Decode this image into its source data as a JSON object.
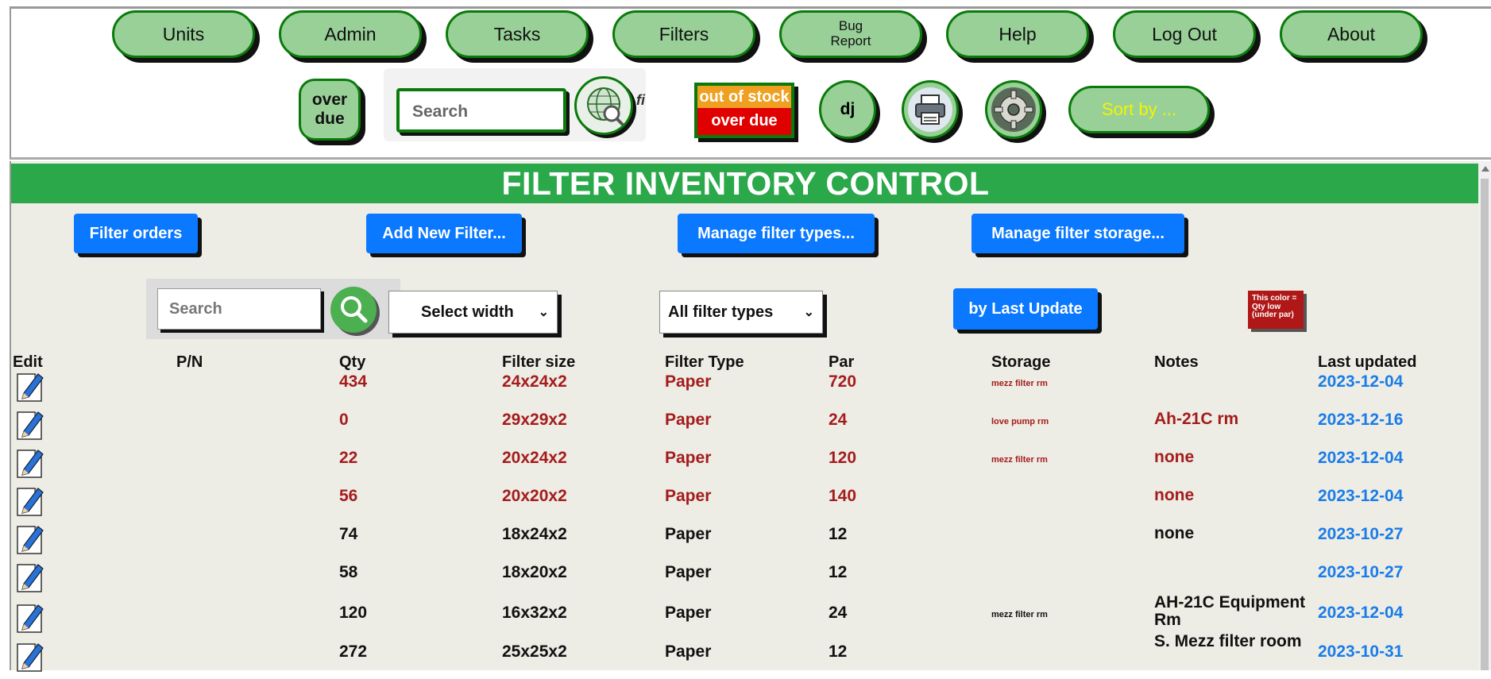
{
  "nav": {
    "buttons": [
      "Units",
      "Admin",
      "Tasks",
      "Filters"
    ],
    "bug_line1": "Bug",
    "bug_line2": "Report",
    "buttons2": [
      "Help",
      "Log Out",
      "About"
    ]
  },
  "toolbar": {
    "overdue_line1": "over",
    "overdue_line2": "due",
    "search_placeholder": "Search",
    "search_suffix": "fi",
    "stock_top": "out of stock",
    "stock_bottom": "over due",
    "user_initials": "dj",
    "sort_label": "Sort by ..."
  },
  "page": {
    "title": "FILTER INVENTORY CONTROL",
    "actions": [
      "Filter orders",
      "Add New Filter...",
      "Manage filter types...",
      "Manage filter storage..."
    ],
    "search_placeholder": "Search",
    "width_select": "Select width",
    "type_select": "All filter types",
    "sort_button": "by Last Update",
    "legend": "This color = Qty low (under par)"
  },
  "table": {
    "headers": [
      "Edit",
      "P/N",
      "Qty",
      "Filter size",
      "Filter Type",
      "Par",
      "Storage",
      "Notes",
      "Last updated"
    ],
    "rows": [
      {
        "qty": "434",
        "size": "24x24x2",
        "type": "Paper",
        "par": "720",
        "storage": "mezz filter rm",
        "notes": "",
        "updated": "2023-12-04",
        "low": true
      },
      {
        "qty": "0",
        "size": "29x29x2",
        "type": "Paper",
        "par": "24",
        "storage": "love pump rm",
        "notes": "Ah-21C rm",
        "updated": "2023-12-16",
        "low": true
      },
      {
        "qty": "22",
        "size": "20x24x2",
        "type": "Paper",
        "par": "120",
        "storage": "mezz filter rm",
        "notes": "none",
        "updated": "2023-12-04",
        "low": true
      },
      {
        "qty": "56",
        "size": "20x20x2",
        "type": "Paper",
        "par": "140",
        "storage": "",
        "notes": "none",
        "updated": "2023-12-04",
        "low": true
      },
      {
        "qty": "74",
        "size": "18x24x2",
        "type": "Paper",
        "par": "12",
        "storage": "",
        "notes": "none",
        "updated": "2023-10-27",
        "low": false
      },
      {
        "qty": "58",
        "size": "18x20x2",
        "type": "Paper",
        "par": "12",
        "storage": "",
        "notes": "",
        "updated": "2023-10-27",
        "low": false
      },
      {
        "qty": "120",
        "size": "16x32x2",
        "type": "Paper",
        "par": "24",
        "storage": "mezz filter rm",
        "notes": "AH-21C Equipment Rm",
        "updated": "2023-12-04",
        "low": false
      },
      {
        "qty": "272",
        "size": "25x25x2",
        "type": "Paper",
        "par": "12",
        "storage": "",
        "notes": "S. Mezz filter room",
        "updated": "2023-10-31",
        "low": false
      }
    ]
  },
  "colors": {
    "nav_fill": "#98d098",
    "nav_border": "#0a7a0a",
    "banner": "#2aa84a",
    "action_blue": "#0a78ff",
    "low_qty_red": "#a41c1c",
    "date_blue": "#1a7ce8"
  }
}
